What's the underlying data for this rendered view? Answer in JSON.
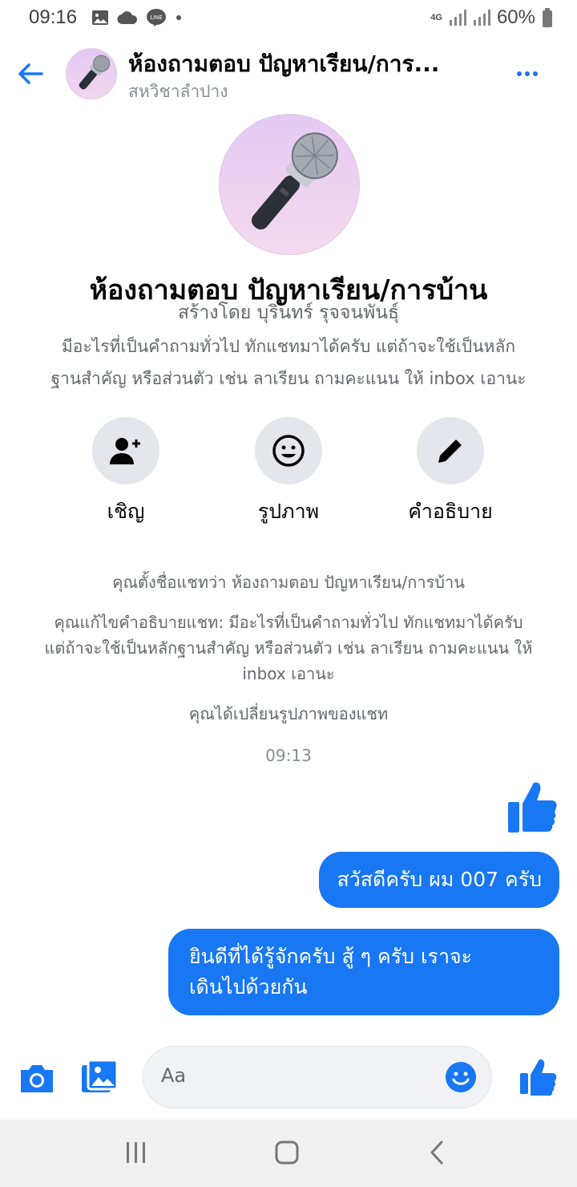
{
  "status_bar": {
    "time": "09:16",
    "network": "4G",
    "battery": "60%"
  },
  "header": {
    "title": "ห้องถามตอบ ปัญหาเรียน/การ...",
    "subtitle": "สหวิชาลำปาง",
    "avatar_icon": "microphone-icon"
  },
  "profile": {
    "name": "ห้องถามตอบ ปัญหาเรียน/การบ้าน",
    "created_by": "สร้างโดย บุรินทร์ รุจจนพันธุ์",
    "description_line1": "มีอะไรที่เป็นคำถามทั่วไป ทักแชทมาได้ครับ แต่ถ้าจะใช้เป็นหลัก",
    "description_line2": "ฐานสำคัญ หรือส่วนตัว เช่น ลาเรียน ถามคะแนน ให้ inbox เอานะ"
  },
  "actions": [
    {
      "label": "เชิญ",
      "icon": "add-person-icon"
    },
    {
      "label": "รูปภาพ",
      "icon": "smiley-icon"
    },
    {
      "label": "คำอธิบาย",
      "icon": "pencil-icon"
    }
  ],
  "events": {
    "rename": "คุณตั้งชื่อแชทว่า ห้องถามตอบ ปัญหาเรียน/การบ้าน",
    "desc_line1": "คุณแก้ไขคำอธิบายแชท: มีอะไรที่เป็นคำถามทั่วไป ทักแชทมาได้ครับ",
    "desc_line2": "แต่ถ้าจะใช้เป็นหลักฐานสำคัญ หรือส่วนตัว เช่น ลาเรียน ถามคะแนน ให้",
    "desc_line3": "inbox เอานะ",
    "photo_change": "คุณได้เปลี่ยนรูปภาพของแชท",
    "timestamp": "09:13"
  },
  "messages": [
    {
      "text": "สวัสดีครับ ผม 007 ครับ"
    },
    {
      "line1": "ยินดีที่ได้รู้จักครับ สู้ ๆ ครับ เราจะ",
      "line2": "เดินไปด้วยกัน"
    }
  ],
  "composer": {
    "placeholder": "Aa"
  },
  "colors": {
    "accent": "#1877f2",
    "bubble_text": "#ffffff",
    "secondary_text": "#65676b"
  }
}
